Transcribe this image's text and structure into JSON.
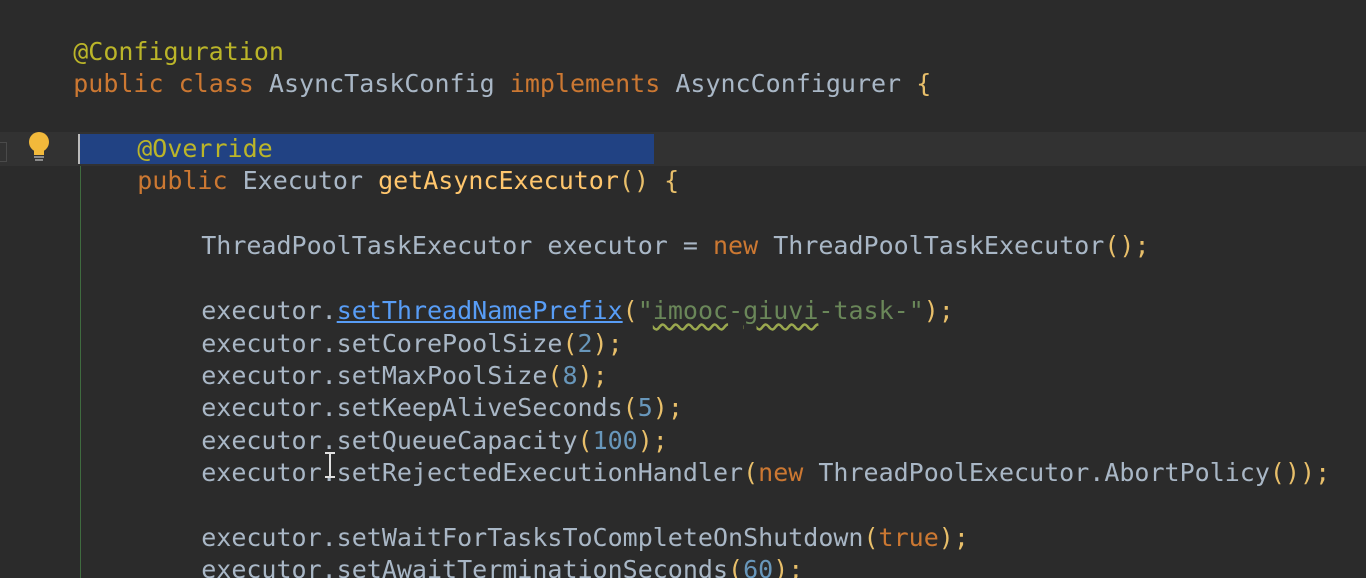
{
  "colors": {
    "background": "#2b2b2b",
    "annotation": "#bbb529",
    "keyword": "#cc7832",
    "method_decl": "#ffc66d",
    "number": "#6897bb",
    "string": "#6a8759",
    "default_text": "#a9b7c6",
    "selection": "#214283"
  },
  "icons": {
    "intention_bulb": "lightbulb-icon",
    "mouse_cursor": "text-cursor-icon"
  },
  "code": {
    "line1": {
      "annotation": "@Configuration"
    },
    "line2": {
      "kw_public": "public",
      "kw_class": "class",
      "class_name": "AsyncTaskConfig",
      "kw_implements": "implements",
      "interface_name": "AsyncConfigurer",
      "brace": "{"
    },
    "line3": {
      "annotation": "@Override"
    },
    "line4": {
      "kw_public": "public",
      "return_type": "Executor",
      "method_name": "getAsyncExecutor",
      "parens": "()",
      "brace": "{"
    },
    "line5": {
      "type": "ThreadPoolTaskExecutor",
      "var_assign": "executor =",
      "kw_new": "new",
      "ctor": "ThreadPoolTaskExecutor",
      "tail": "();"
    },
    "line6": {
      "obj": "executor.",
      "method": "setThreadNamePrefix",
      "open": "(",
      "arg_a": "\"",
      "arg_b": "imooc",
      "arg_c": "-",
      "arg_d": "giuvi",
      "arg_e": "-task-\"",
      "close": ");"
    },
    "line7": {
      "call": "executor.setCorePoolSize",
      "open": "(",
      "arg": "2",
      "close": ");"
    },
    "line8": {
      "call": "executor.setMaxPoolSize",
      "open": "(",
      "arg": "8",
      "close": ");"
    },
    "line9": {
      "call": "executor.setKeepAliveSeconds",
      "open": "(",
      "arg": "5",
      "close": ");"
    },
    "line10": {
      "call": "executor.setQueueCapacity",
      "open": "(",
      "arg": "100",
      "close": ");"
    },
    "line11": {
      "call": "executor.setRejectedExecutionHandler",
      "open": "(",
      "kw_new": "new",
      "arg": "ThreadPoolExecutor.AbortPolicy",
      "inner_parens": "()",
      "close": ");"
    },
    "line12": {
      "call": "executor.setWaitForTasksToCompleteOnShutdown",
      "open": "(",
      "kw_true": "true",
      "close": ");"
    },
    "line13": {
      "call": "executor.setAwaitTerminationSeconds",
      "open": "(",
      "arg": "60",
      "close": ");"
    }
  }
}
